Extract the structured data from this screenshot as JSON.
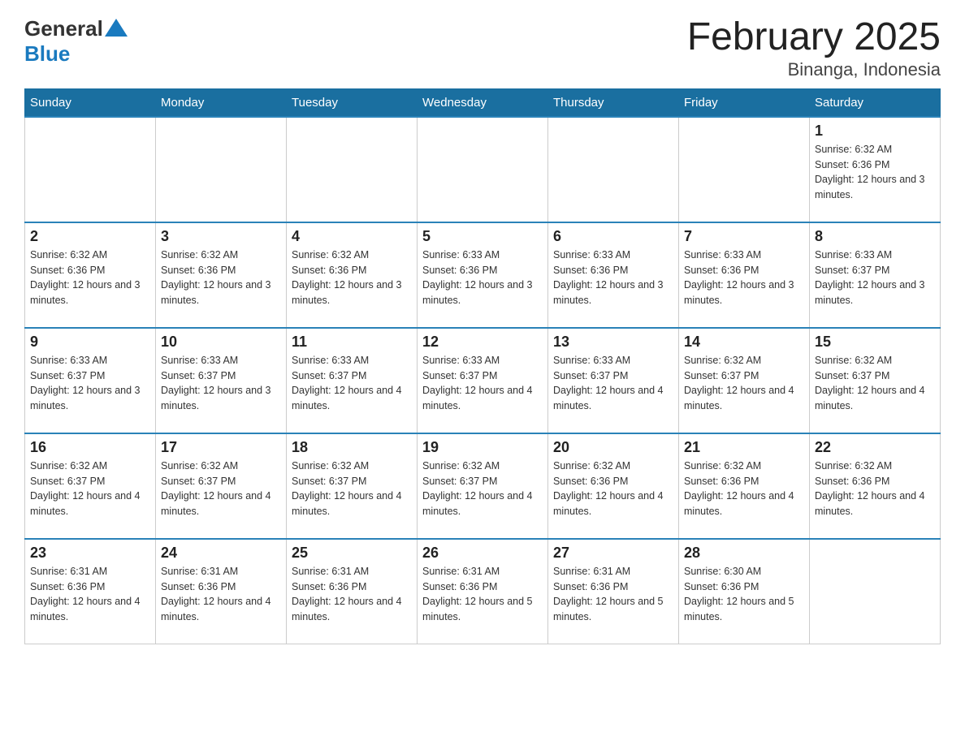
{
  "logo": {
    "general": "General",
    "blue": "Blue"
  },
  "title": "February 2025",
  "location": "Binanga, Indonesia",
  "days_of_week": [
    "Sunday",
    "Monday",
    "Tuesday",
    "Wednesday",
    "Thursday",
    "Friday",
    "Saturday"
  ],
  "weeks": [
    [
      {
        "day": "",
        "info": ""
      },
      {
        "day": "",
        "info": ""
      },
      {
        "day": "",
        "info": ""
      },
      {
        "day": "",
        "info": ""
      },
      {
        "day": "",
        "info": ""
      },
      {
        "day": "",
        "info": ""
      },
      {
        "day": "1",
        "info": "Sunrise: 6:32 AM\nSunset: 6:36 PM\nDaylight: 12 hours and 3 minutes."
      }
    ],
    [
      {
        "day": "2",
        "info": "Sunrise: 6:32 AM\nSunset: 6:36 PM\nDaylight: 12 hours and 3 minutes."
      },
      {
        "day": "3",
        "info": "Sunrise: 6:32 AM\nSunset: 6:36 PM\nDaylight: 12 hours and 3 minutes."
      },
      {
        "day": "4",
        "info": "Sunrise: 6:32 AM\nSunset: 6:36 PM\nDaylight: 12 hours and 3 minutes."
      },
      {
        "day": "5",
        "info": "Sunrise: 6:33 AM\nSunset: 6:36 PM\nDaylight: 12 hours and 3 minutes."
      },
      {
        "day": "6",
        "info": "Sunrise: 6:33 AM\nSunset: 6:36 PM\nDaylight: 12 hours and 3 minutes."
      },
      {
        "day": "7",
        "info": "Sunrise: 6:33 AM\nSunset: 6:36 PM\nDaylight: 12 hours and 3 minutes."
      },
      {
        "day": "8",
        "info": "Sunrise: 6:33 AM\nSunset: 6:37 PM\nDaylight: 12 hours and 3 minutes."
      }
    ],
    [
      {
        "day": "9",
        "info": "Sunrise: 6:33 AM\nSunset: 6:37 PM\nDaylight: 12 hours and 3 minutes."
      },
      {
        "day": "10",
        "info": "Sunrise: 6:33 AM\nSunset: 6:37 PM\nDaylight: 12 hours and 3 minutes."
      },
      {
        "day": "11",
        "info": "Sunrise: 6:33 AM\nSunset: 6:37 PM\nDaylight: 12 hours and 4 minutes."
      },
      {
        "day": "12",
        "info": "Sunrise: 6:33 AM\nSunset: 6:37 PM\nDaylight: 12 hours and 4 minutes."
      },
      {
        "day": "13",
        "info": "Sunrise: 6:33 AM\nSunset: 6:37 PM\nDaylight: 12 hours and 4 minutes."
      },
      {
        "day": "14",
        "info": "Sunrise: 6:32 AM\nSunset: 6:37 PM\nDaylight: 12 hours and 4 minutes."
      },
      {
        "day": "15",
        "info": "Sunrise: 6:32 AM\nSunset: 6:37 PM\nDaylight: 12 hours and 4 minutes."
      }
    ],
    [
      {
        "day": "16",
        "info": "Sunrise: 6:32 AM\nSunset: 6:37 PM\nDaylight: 12 hours and 4 minutes."
      },
      {
        "day": "17",
        "info": "Sunrise: 6:32 AM\nSunset: 6:37 PM\nDaylight: 12 hours and 4 minutes."
      },
      {
        "day": "18",
        "info": "Sunrise: 6:32 AM\nSunset: 6:37 PM\nDaylight: 12 hours and 4 minutes."
      },
      {
        "day": "19",
        "info": "Sunrise: 6:32 AM\nSunset: 6:37 PM\nDaylight: 12 hours and 4 minutes."
      },
      {
        "day": "20",
        "info": "Sunrise: 6:32 AM\nSunset: 6:36 PM\nDaylight: 12 hours and 4 minutes."
      },
      {
        "day": "21",
        "info": "Sunrise: 6:32 AM\nSunset: 6:36 PM\nDaylight: 12 hours and 4 minutes."
      },
      {
        "day": "22",
        "info": "Sunrise: 6:32 AM\nSunset: 6:36 PM\nDaylight: 12 hours and 4 minutes."
      }
    ],
    [
      {
        "day": "23",
        "info": "Sunrise: 6:31 AM\nSunset: 6:36 PM\nDaylight: 12 hours and 4 minutes."
      },
      {
        "day": "24",
        "info": "Sunrise: 6:31 AM\nSunset: 6:36 PM\nDaylight: 12 hours and 4 minutes."
      },
      {
        "day": "25",
        "info": "Sunrise: 6:31 AM\nSunset: 6:36 PM\nDaylight: 12 hours and 4 minutes."
      },
      {
        "day": "26",
        "info": "Sunrise: 6:31 AM\nSunset: 6:36 PM\nDaylight: 12 hours and 5 minutes."
      },
      {
        "day": "27",
        "info": "Sunrise: 6:31 AM\nSunset: 6:36 PM\nDaylight: 12 hours and 5 minutes."
      },
      {
        "day": "28",
        "info": "Sunrise: 6:30 AM\nSunset: 6:36 PM\nDaylight: 12 hours and 5 minutes."
      },
      {
        "day": "",
        "info": ""
      }
    ]
  ]
}
